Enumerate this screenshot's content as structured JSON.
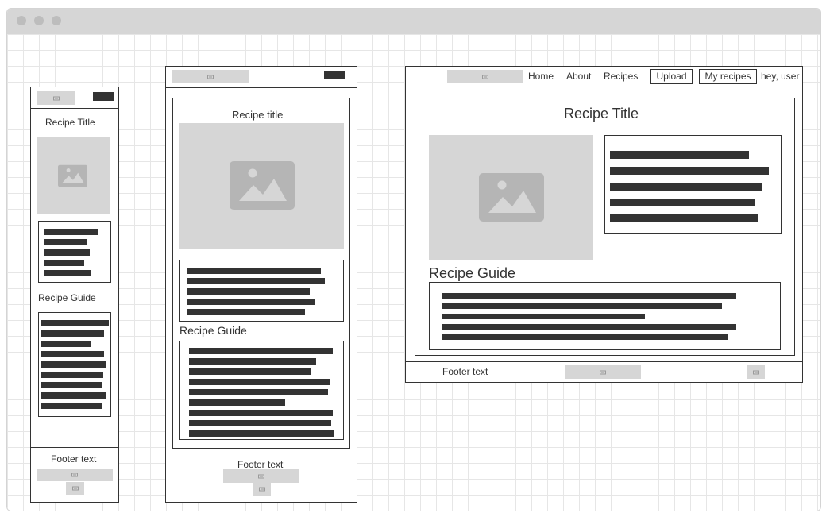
{
  "mobile": {
    "recipe_title": "Recipe Title",
    "recipe_guide": "Recipe Guide",
    "footer_text": "Footer text"
  },
  "tablet": {
    "recipe_title": "Recipe title",
    "recipe_guide": "Recipe Guide",
    "footer_text": "Footer text"
  },
  "desktop": {
    "nav": {
      "home": "Home",
      "about": "About",
      "recipes": "Recipes",
      "upload": "Upload",
      "my_recipes": "My recipes",
      "greeting": "hey, user"
    },
    "recipe_title": "Recipe Title",
    "recipe_guide": "Recipe Guide",
    "footer_text": "Footer text"
  },
  "colors": {
    "placeholder": "#d6d6d6",
    "line": "#333333",
    "grid": "#e6e6e6",
    "titlebar": "#d6d6d6"
  },
  "icons": [
    "image-icon",
    "placeholder-image-icon"
  ]
}
